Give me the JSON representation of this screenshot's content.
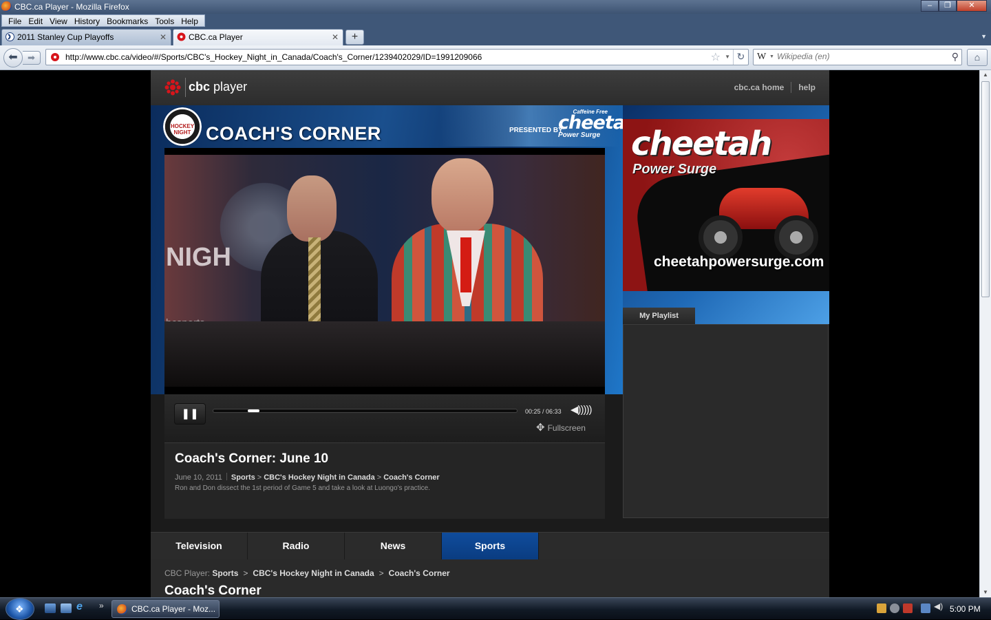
{
  "window": {
    "title": "CBC.ca Player - Mozilla Firefox",
    "buttons": [
      "–",
      "❐",
      "✕"
    ]
  },
  "menu": [
    "File",
    "Edit",
    "View",
    "History",
    "Bookmarks",
    "Tools",
    "Help"
  ],
  "tabs": [
    {
      "label": "2011 Stanley Cup Playoffs",
      "active": false
    },
    {
      "label": "CBC.ca Player",
      "active": true
    }
  ],
  "nav": {
    "url": "http://www.cbc.ca/video/#/Sports/CBC's_Hockey_Night_in_Canada/Coach's_Corner/1239402029/ID=1991209066",
    "search_placeholder": "Wikipedia (en)"
  },
  "site": {
    "brand": "cbc",
    "brand_suffix": "player",
    "links": [
      "cbc.ca home",
      "help"
    ]
  },
  "banner": {
    "badge": "HOCKEY NIGHT",
    "title": "COACH'S CORNER",
    "presented_by": "PRESENTED BY",
    "sponsor_top": "Caffeine Free",
    "sponsor": "cheetah",
    "sponsor_sub": "Power Surge"
  },
  "video": {
    "overlay_text": "NIGH",
    "overlay_sub": "bcsports"
  },
  "player": {
    "pause_label": "❚❚",
    "progress": 0.064,
    "current_time": "00:25",
    "total_time": "06:33",
    "time_sep": " / ",
    "fullscreen_label": "Fullscreen"
  },
  "clip": {
    "title": "Coach's Corner: June 10",
    "date": "June 10, 2011",
    "path": [
      "Sports",
      "CBC's Hockey Night in Canada",
      "Coach's Corner"
    ],
    "description": "Ron and Don dissect the 1st period of Game 5 and take a look at Luongo's practice."
  },
  "ad": {
    "brand": "cheetah",
    "tagline": "Power Surge",
    "url": "cheetahpowersurge.com"
  },
  "playlist": {
    "tab_label": "My Playlist"
  },
  "sections": [
    {
      "label": "Television",
      "active": false
    },
    {
      "label": "Radio",
      "active": false
    },
    {
      "label": "News",
      "active": false
    },
    {
      "label": "Sports",
      "active": true
    }
  ],
  "breadcrumb": {
    "prefix": "CBC Player:",
    "items": [
      "Sports",
      "CBC's Hockey Night in Canada",
      "Coach's Corner"
    ]
  },
  "section_title": "Coach's Corner",
  "taskbar": {
    "task_label": "CBC.ca Player - Moz...",
    "clock": "5:00 PM",
    "quicklaunch_more": "»"
  },
  "colors": {
    "accent_blue": "#0a3c80",
    "cbc_red": "#d7151b"
  }
}
